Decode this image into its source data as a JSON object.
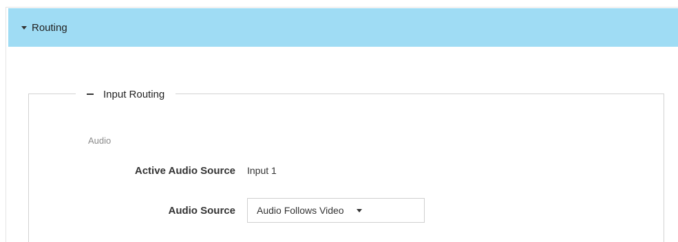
{
  "section": {
    "title": "Routing",
    "expand_icon": "caret-down-icon"
  },
  "input_routing": {
    "title": "Input Routing",
    "collapse_icon": "minus-icon",
    "group_label": "Audio",
    "active_audio_source": {
      "label": "Active Audio Source",
      "value": "Input 1"
    },
    "audio_source": {
      "label": "Audio Source",
      "selected": "Audio Follows Video",
      "dropdown_icon": "caret-down-icon"
    }
  },
  "colors": {
    "header_background": "#9fdcf4",
    "border": "#d2d2d2",
    "muted_text": "#8a8a8a"
  }
}
